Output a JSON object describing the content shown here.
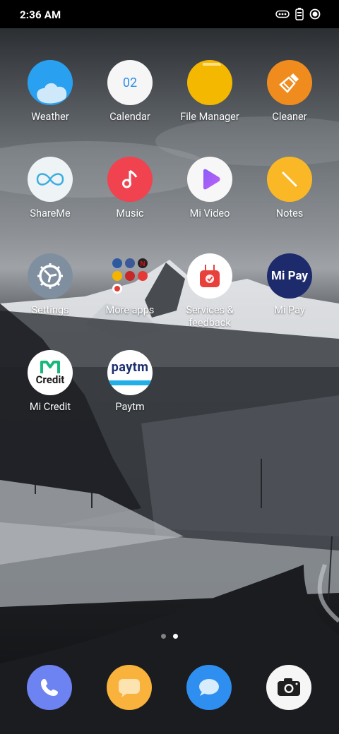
{
  "status_bar": {
    "time": "2:36 AM"
  },
  "apps": [
    {
      "label": "Weather",
      "icon": "weather-icon"
    },
    {
      "label": "Calendar",
      "icon": "calendar-icon",
      "date": "02"
    },
    {
      "label": "File Manager",
      "icon": "folder-icon"
    },
    {
      "label": "Cleaner",
      "icon": "broom-icon"
    },
    {
      "label": "ShareMe",
      "icon": "infinity-icon"
    },
    {
      "label": "Music",
      "icon": "music-note-icon"
    },
    {
      "label": "Mi Video",
      "icon": "play-icon"
    },
    {
      "label": "Notes",
      "icon": "pencil-icon"
    },
    {
      "label": "Settings",
      "icon": "gear-icon"
    },
    {
      "label": "More apps",
      "icon": "folder-grid-icon"
    },
    {
      "label": "Services &\nfeedback",
      "icon": "service-bag-icon"
    },
    {
      "label": "Mi Pay",
      "icon": "mipay-icon",
      "icon_text": "Mi Pay"
    },
    {
      "label": "Mi Credit",
      "icon": "micredit-icon",
      "icon_text": "Credit"
    },
    {
      "label": "Paytm",
      "icon": "paytm-icon",
      "icon_text": "Paytm"
    }
  ],
  "pager": {
    "pages": 2,
    "active": 2
  },
  "dock": [
    {
      "name": "phone",
      "icon": "phone-icon"
    },
    {
      "name": "messaging",
      "icon": "chat-bubble-icon"
    },
    {
      "name": "browser",
      "icon": "browser-bubble-icon"
    },
    {
      "name": "camera",
      "icon": "camera-icon"
    }
  ],
  "colors": {
    "weather": "#2aa3f2",
    "calendar": "#f6f6f6",
    "file_manager": "#f5b800",
    "cleaner": "#f08c1e",
    "shareme": "#eef3f6",
    "music": "#f0424f",
    "mi_video": "#f7f7f7",
    "notes": "#fbb826",
    "settings": "#7f8f9f",
    "services": "#ffffff",
    "mi_pay": "#1d2a6c",
    "mi_credit": "#ffffff",
    "paytm": "#ffffff",
    "phone": "#6d83f2",
    "messaging": "#f9b23b",
    "browser": "#2f8ff0",
    "camera": "#f6f6f6"
  }
}
